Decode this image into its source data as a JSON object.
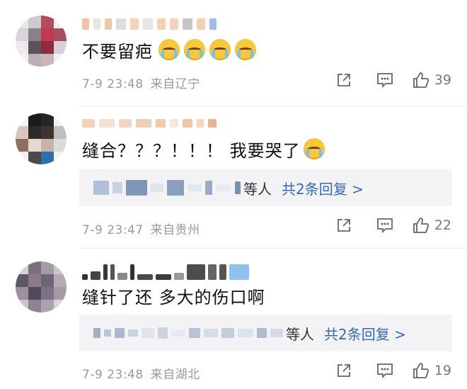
{
  "comments": [
    {
      "text": "不要留疤",
      "emoji_count": 4,
      "emoji": "crying-face",
      "date": "7-9",
      "time": "23:48",
      "location": "来自辽宁",
      "likes": "39"
    },
    {
      "text": "缝合？？？！！！ 我要哭了",
      "emoji_count": 1,
      "emoji": "crying-face",
      "date": "7-9",
      "time": "23:47",
      "location": "来自贵州",
      "likes": "22",
      "reply_suffix": "等人",
      "reply_link": "共2条回复 >"
    },
    {
      "text": "缝针了还 多大的伤口啊",
      "date": "7-9",
      "time": "23:48",
      "location": "来自湖北",
      "likes": "19",
      "reply_suffix": "等人",
      "reply_link": "共2条回复 >"
    }
  ],
  "icons": {
    "share": "share-icon",
    "comment": "comment-icon",
    "like": "thumbs-up-icon"
  },
  "colors": {
    "link": "#3569b4",
    "meta": "#9a9a9a",
    "reply_bg": "#f3f3f5"
  }
}
